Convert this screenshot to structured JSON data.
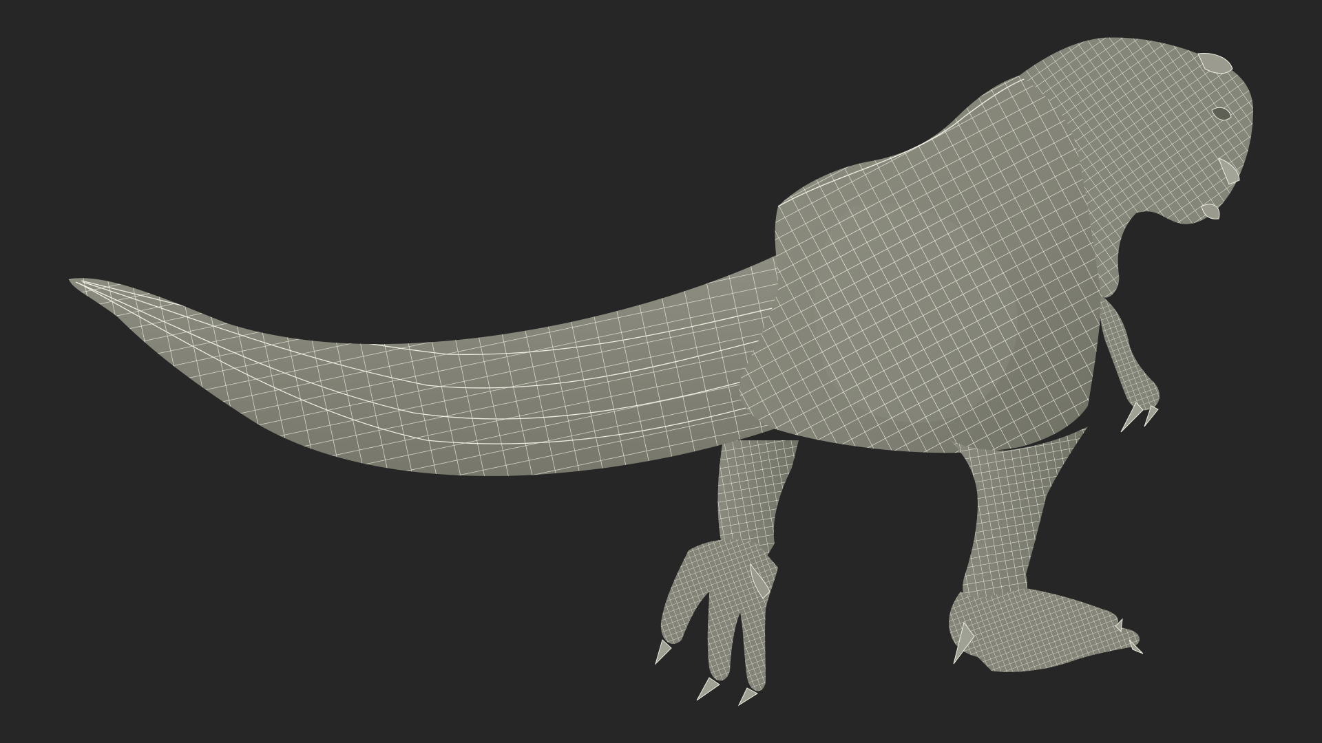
{
  "scene": {
    "subject": "dinosaur-wireframe-model",
    "view": "rear-three-quarter",
    "render_mode": "wireframe-over-clay"
  },
  "colors": {
    "background": "#262626",
    "body_fill": "#86877a",
    "body_shade": "#6f7064",
    "wire": "#eeeee2",
    "claw_fill": "#a0a195"
  }
}
